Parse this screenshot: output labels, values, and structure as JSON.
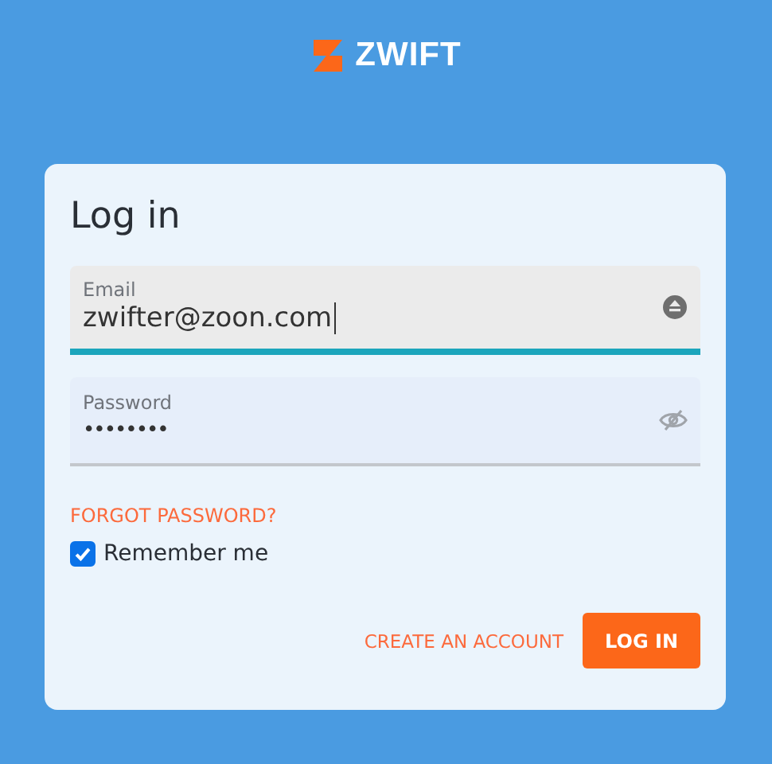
{
  "logo": {
    "text": "ZWIFT"
  },
  "title": "Log in",
  "fields": [
    {
      "label": "Email",
      "value": "zwifter@zoon.com",
      "focused": true,
      "kind": "email"
    },
    {
      "label": "Password",
      "value": "••••••••",
      "focused": false,
      "kind": "password"
    }
  ],
  "forgot_link": "FORGOT PASSWORD?",
  "remember": {
    "label": "Remember me",
    "checked": true
  },
  "create_link": "CREATE AN ACCOUNT",
  "login_button": "LOG IN"
}
